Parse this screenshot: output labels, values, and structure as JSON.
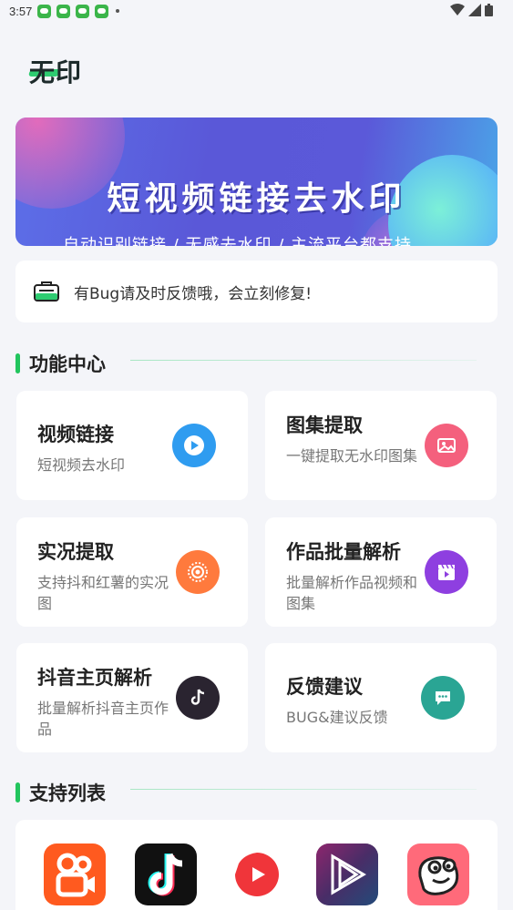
{
  "status": {
    "time": "3:57"
  },
  "app": {
    "logo_text": "无印"
  },
  "banner": {
    "title": "短视频链接去水印",
    "subtitle": "自动识别链接 / 无感去水印 / 主流平台都支持"
  },
  "notice": {
    "text": "有Bug请及时反馈哦，会立刻修复!"
  },
  "sections": {
    "functions": "功能中心",
    "supported": "支持列表"
  },
  "cards": [
    {
      "title": "视频链接",
      "subtitle": "短视频去水印",
      "icon": "play-icon",
      "color": "#2f9cf0"
    },
    {
      "title": "图集提取",
      "subtitle": "一键提取无水印图集",
      "icon": "image-icon",
      "color": "#f4607d"
    },
    {
      "title": "实况提取",
      "subtitle": "支持抖和红薯的实况图",
      "icon": "live-photo-icon",
      "color": "#ff7a3d"
    },
    {
      "title": "作品批量解析",
      "subtitle": "批量解析作品视频和图集",
      "icon": "clapper-icon",
      "color": "#8e3fe0"
    },
    {
      "title": "抖音主页解析",
      "subtitle": "批量解析抖音主页作品",
      "icon": "tiktok-icon",
      "color": "#2a2430"
    },
    {
      "title": "反馈建议",
      "subtitle": "BUG&建议反馈",
      "icon": "chat-icon",
      "color": "#2aa594"
    }
  ],
  "supported_apps": [
    {
      "name": "kuaishou-app-icon",
      "color": "#ff5a1f"
    },
    {
      "name": "douyin-app-icon",
      "color": "#111111"
    },
    {
      "name": "xigua-app-icon",
      "color": "#ffffff"
    },
    {
      "name": "video-app-icon",
      "color": "#1a0f2e"
    },
    {
      "name": "pipixia-app-icon",
      "color": "#ff6a7a"
    }
  ]
}
